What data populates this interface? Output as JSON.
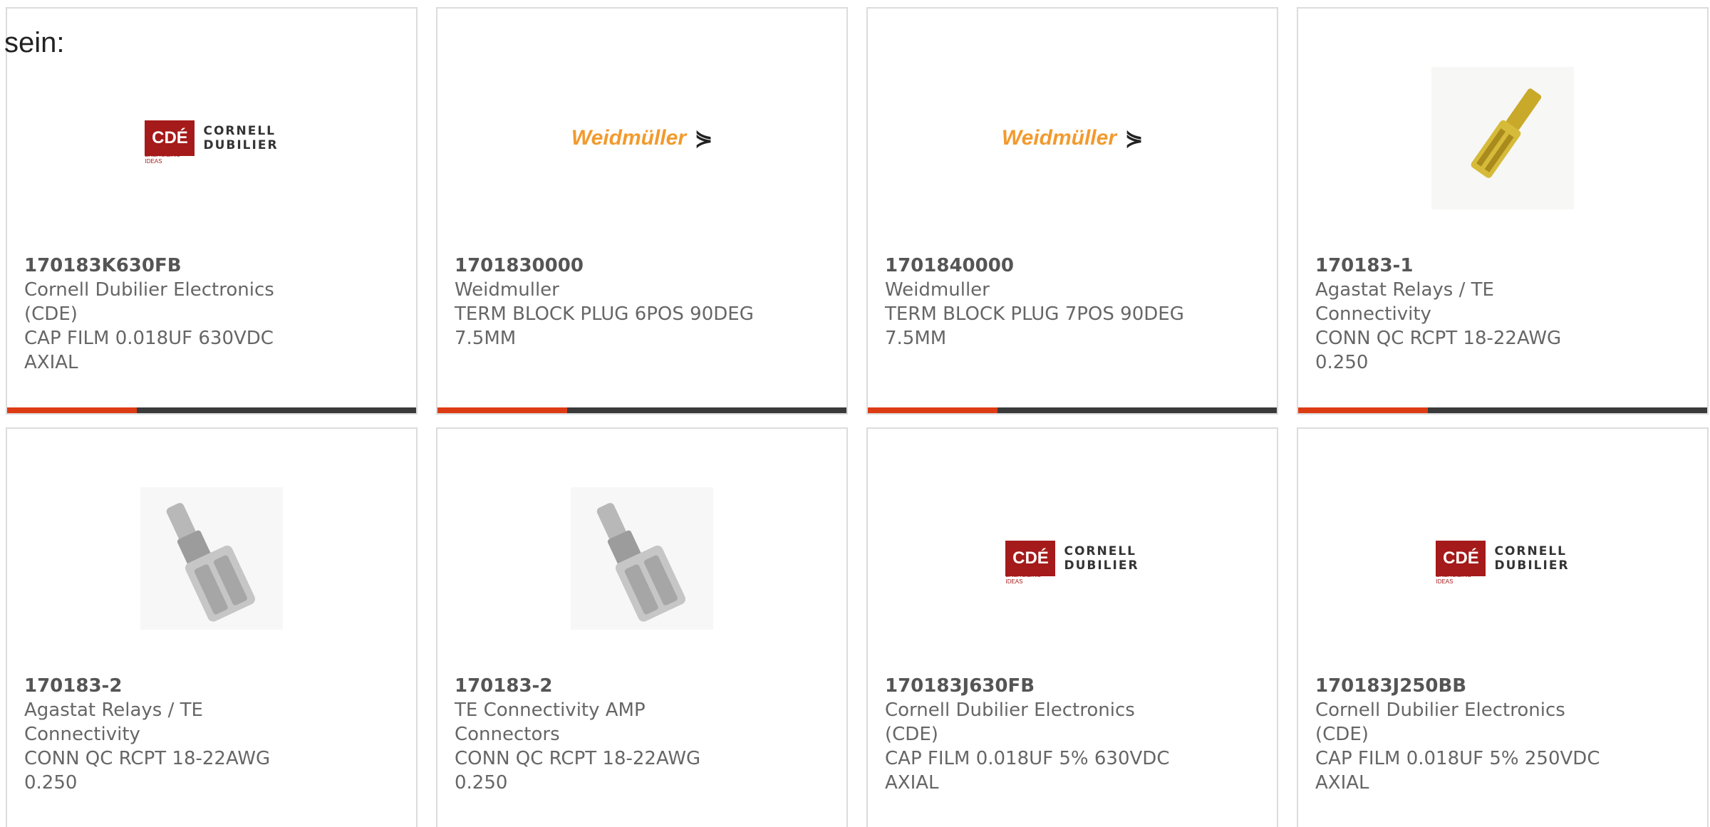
{
  "intro_text": "sein:",
  "colors": {
    "accent": "#dd3b14",
    "bar": "#3a3a3a",
    "border": "#dcdcdc",
    "text": "#666666",
    "cde_red": "#a51a1a",
    "weidmuller_orange": "#f29a2e"
  },
  "products": [
    {
      "part_number": "170183K630FB",
      "manufacturer": "Cornell Dubilier Electronics (CDE)",
      "description": "CAP FILM 0.018UF 630VDC AXIAL",
      "image": "cde-logo"
    },
    {
      "part_number": "1701830000",
      "manufacturer": "Weidmuller",
      "description": "TERM BLOCK PLUG 6POS 90DEG 7.5MM",
      "image": "weidmuller-logo"
    },
    {
      "part_number": "1701840000",
      "manufacturer": "Weidmuller",
      "description": "TERM BLOCK PLUG 7POS 90DEG 7.5MM",
      "image": "weidmuller-logo"
    },
    {
      "part_number": "170183-1",
      "manufacturer": "Agastat Relays / TE Connectivity",
      "description": "CONN QC RCPT 18-22AWG 0.250",
      "image": "gold-quick-connect-photo"
    },
    {
      "part_number": "170183-2",
      "manufacturer": "Agastat Relays / TE Connectivity",
      "description": "CONN QC RCPT 18-22AWG 0.250",
      "image": "silver-quick-connect-photo"
    },
    {
      "part_number": "170183-2",
      "manufacturer": "TE Connectivity AMP Connectors",
      "description": "CONN QC RCPT 18-22AWG 0.250",
      "image": "silver-quick-connect-photo"
    },
    {
      "part_number": "170183J630FB",
      "manufacturer": "Cornell Dubilier Electronics (CDE)",
      "description": "CAP FILM 0.018UF 5% 630VDC AXIAL",
      "image": "cde-logo"
    },
    {
      "part_number": "170183J250BB",
      "manufacturer": "Cornell Dubilier Electronics (CDE)",
      "description": "CAP FILM 0.018UF 5% 250VDC AXIAL",
      "image": "cde-logo"
    }
  ],
  "logos": {
    "cde": {
      "box": "CDÉ",
      "word1": "CORNELL",
      "word2": "DUBILIER",
      "tagline": "ENERGIZING IDEAS"
    },
    "weidmuller": {
      "word": "Weidmüller",
      "mark": "⋟"
    }
  }
}
